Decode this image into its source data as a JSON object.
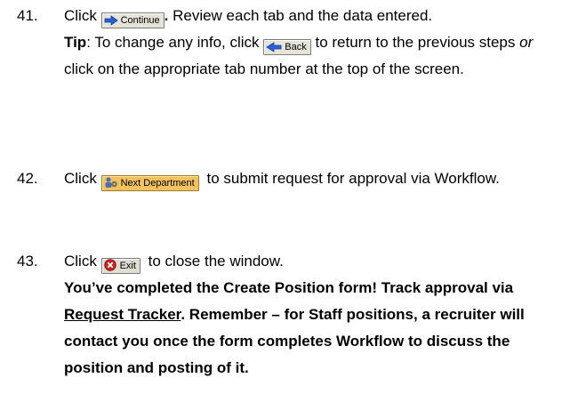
{
  "steps": [
    {
      "number": "41.",
      "click": "Click",
      "button": "Continue",
      "after_button": ".",
      "text1": " Review each tab and the data entered. ",
      "tip_label": "Tip",
      "tip_text": ": To change any info, click",
      "back_button": "Back",
      "text2": "to return to the previous steps ",
      "or_word": "or",
      "text3": " click on the appropriate tab number at the top of the screen."
    },
    {
      "number": "42.",
      "click": "Click",
      "button": "Next Department",
      "text": "to submit request for approval via Workflow."
    },
    {
      "number": "43.",
      "click": "Click",
      "button": "Exit",
      "text": "to close the window.",
      "bold1": "You’ve completed the Create Position form! Track approval via",
      "link": "Request Tracker",
      "bold2": ". Remember – for Staff positions, a recruiter will contact you once the form completes Workflow to discuss the position and posting of it."
    }
  ],
  "colors": {
    "continue_arrow": "#2a5fd6",
    "back_arrow": "#2a5fd6",
    "next_button_bg": "#f3c25c",
    "exit_icon": "#cc2222"
  },
  "icons": {
    "continue": "right-arrow-icon",
    "back": "left-arrow-icon",
    "next": "people-gear-icon",
    "exit": "stop-x-icon"
  }
}
